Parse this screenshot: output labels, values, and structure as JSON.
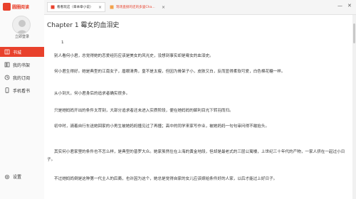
{
  "app": {
    "logo_text": "圆圈阅读"
  },
  "sidebar": {
    "login_label": "立即登录",
    "items": [
      {
        "label": "书城",
        "icon": "bookstore-icon",
        "active": true
      },
      {
        "label": "我的书架",
        "icon": "bookshelf-icon",
        "active": false
      },
      {
        "label": "我的订阅",
        "icon": "subscription-icon",
        "active": false
      },
      {
        "label": "手机看书",
        "icon": "phone-icon",
        "active": false
      }
    ],
    "settings_label": "设置"
  },
  "tabs": [
    {
      "label": "看看玩这（章本章小说）",
      "active": true
    },
    {
      "label": "现场直接的还的多里Cha...",
      "active": false
    }
  ],
  "reader": {
    "chapter_title": "Chapter 1 霉女的血泪史",
    "paragraphs": [
      "1",
      "别人看何小君，总觉得她的恋爱经历应该是美女的风光史，没想到事实却是霉女的血泪史。",
      "何小君生得好。她是典型的江南女子，眉眼清秀，皇不是太瘦，但因为骨架子小，皮肤又白，反而显得柔软可爱，白色棉花糖一样。",
      "从小到大，何小君身后的追求者确实很多。",
      "只是她妈妈开出的条件太苛刻，大部分追求者还未进入实质阶段，便在她妈妈的犀利目光下转羽而归。",
      "初中时，骑着自行车送她回家的小男生被她妈妈撞见过了再撞；高中的同学来家写作业，被她妈妈一句句审问得不敢抬头。",
      "其实何小君家里的条件也不怎么样，是典型的普罗大众。她家虽然住在上海的黄金地段，但却是最老式的三层公寓楼，上世纪三十年代的产物，一家人挤在一起过小日子。",
      "不过她妈妈倒是这种第一代主人的后裔，也许因为这个，她总是觉得自家的女儿应该嫁给条件好的人家，以后才能过上好日子。"
    ]
  }
}
